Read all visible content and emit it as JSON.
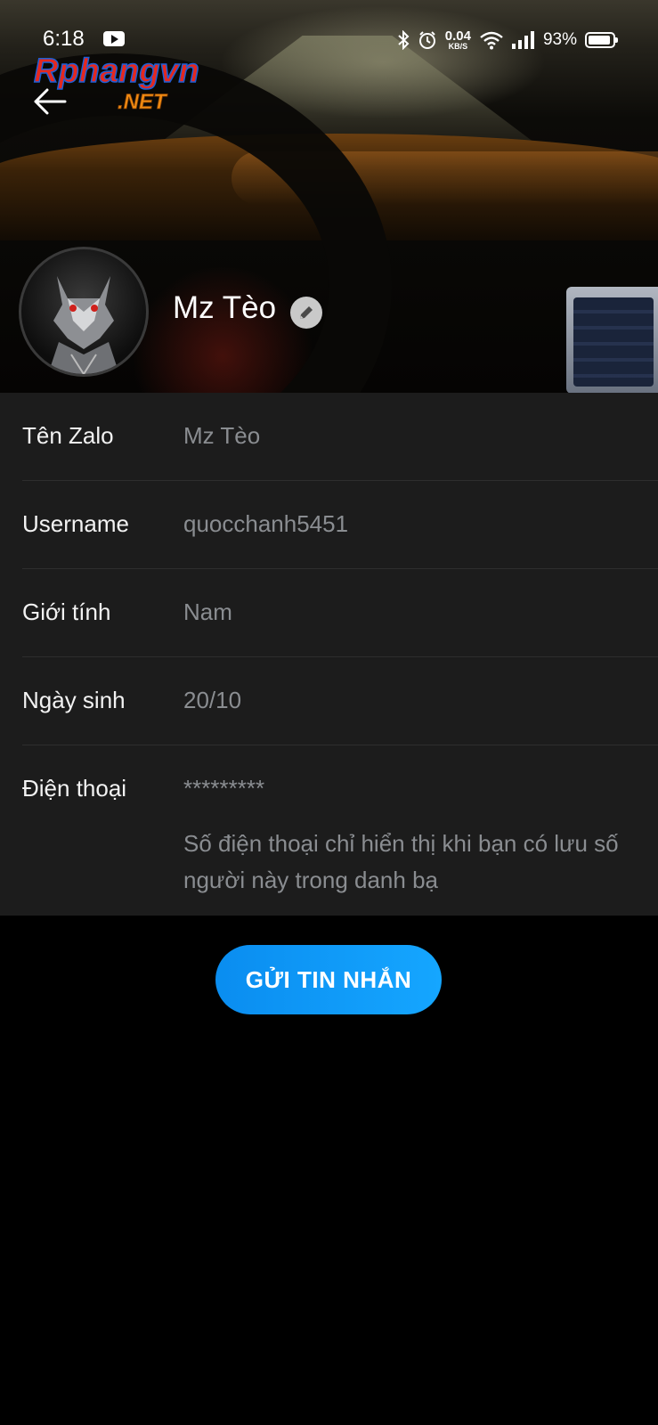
{
  "status_bar": {
    "time": "6:18",
    "net_speed_value": "0.04",
    "net_speed_unit": "KB/S",
    "battery_percent": "93%",
    "battery_level": 0.93,
    "icons": [
      "youtube-icon",
      "bluetooth-icon",
      "alarm-icon",
      "wifi-icon",
      "signal-icon",
      "battery-icon"
    ]
  },
  "watermark": {
    "text_main": "Rphangvn",
    "text_sub": ".NET",
    "colors": {
      "main": "#e5281f",
      "outline": "#1d5fd6",
      "sub": "#f08a12"
    }
  },
  "header": {
    "back_icon": "arrow-left-icon",
    "profile_name": "Mz Tèo",
    "edit_icon": "pencil-icon"
  },
  "info": {
    "rows": [
      {
        "label": "Tên Zalo",
        "value": "Mz Tèo"
      },
      {
        "label": "Username",
        "value": "quocchanh5451"
      },
      {
        "label": "Giới tính",
        "value": "Nam"
      },
      {
        "label": "Ngày sinh",
        "value": "20/10"
      },
      {
        "label": "Điện thoại",
        "value": "*********",
        "note": "Số điện thoại chỉ hiển thị khi bạn có lưu số người này trong danh bạ"
      }
    ]
  },
  "actions": {
    "send_message_label": "GỬI TIN NHẮN"
  },
  "colors": {
    "accent": "#0a8df0",
    "card_background": "#1c1c1c",
    "value_text": "#8a8d91"
  }
}
